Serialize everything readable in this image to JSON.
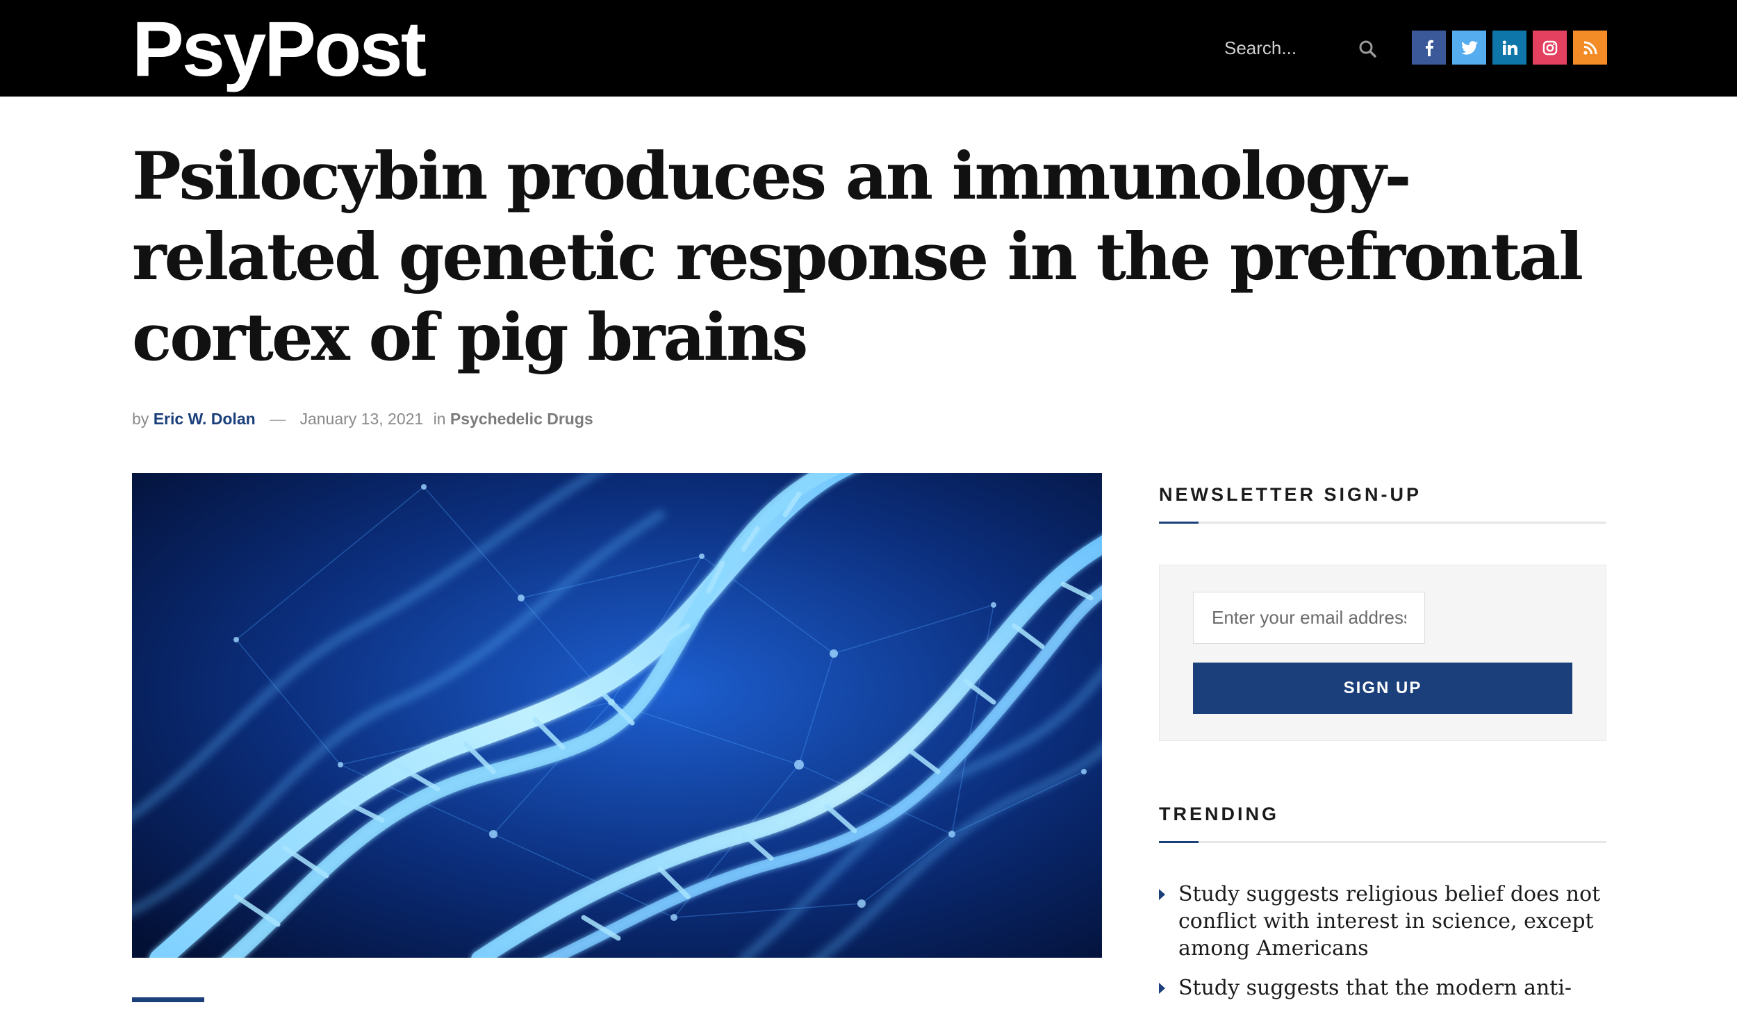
{
  "header": {
    "logo": "PsyPost",
    "search_placeholder": "Search...",
    "socials": [
      {
        "name": "facebook",
        "glyph": "f",
        "color": "#3b5998"
      },
      {
        "name": "twitter",
        "glyph": "🐦",
        "color": "#55acee"
      },
      {
        "name": "linkedin",
        "glyph": "in",
        "color": "#0e76a8"
      },
      {
        "name": "instagram",
        "glyph": "◎",
        "color": "#e4405f"
      },
      {
        "name": "rss",
        "glyph": "rss",
        "color": "#f38b26"
      }
    ]
  },
  "article": {
    "title": "Psilocybin produces an immunology-related genetic response in the prefrontal cortex of pig brains",
    "byline_prefix": "by",
    "author": "Eric W. Dolan",
    "date": "January 13, 2021",
    "in_label": "in",
    "category": "Psychedelic Drugs",
    "hero_image": "dna-double-helix-image"
  },
  "sidebar": {
    "newsletter": {
      "title": "NEWSLETTER SIGN-UP",
      "email_placeholder": "Enter your email address",
      "button_label": "SIGN UP"
    },
    "trending": {
      "title": "TRENDING",
      "items": [
        "Study suggests religious belief does not conflict with interest in science, except among Americans",
        "Study suggests that the modern anti-"
      ]
    }
  },
  "colors": {
    "accent": "#1a3f7a",
    "header_bg": "#000000"
  }
}
